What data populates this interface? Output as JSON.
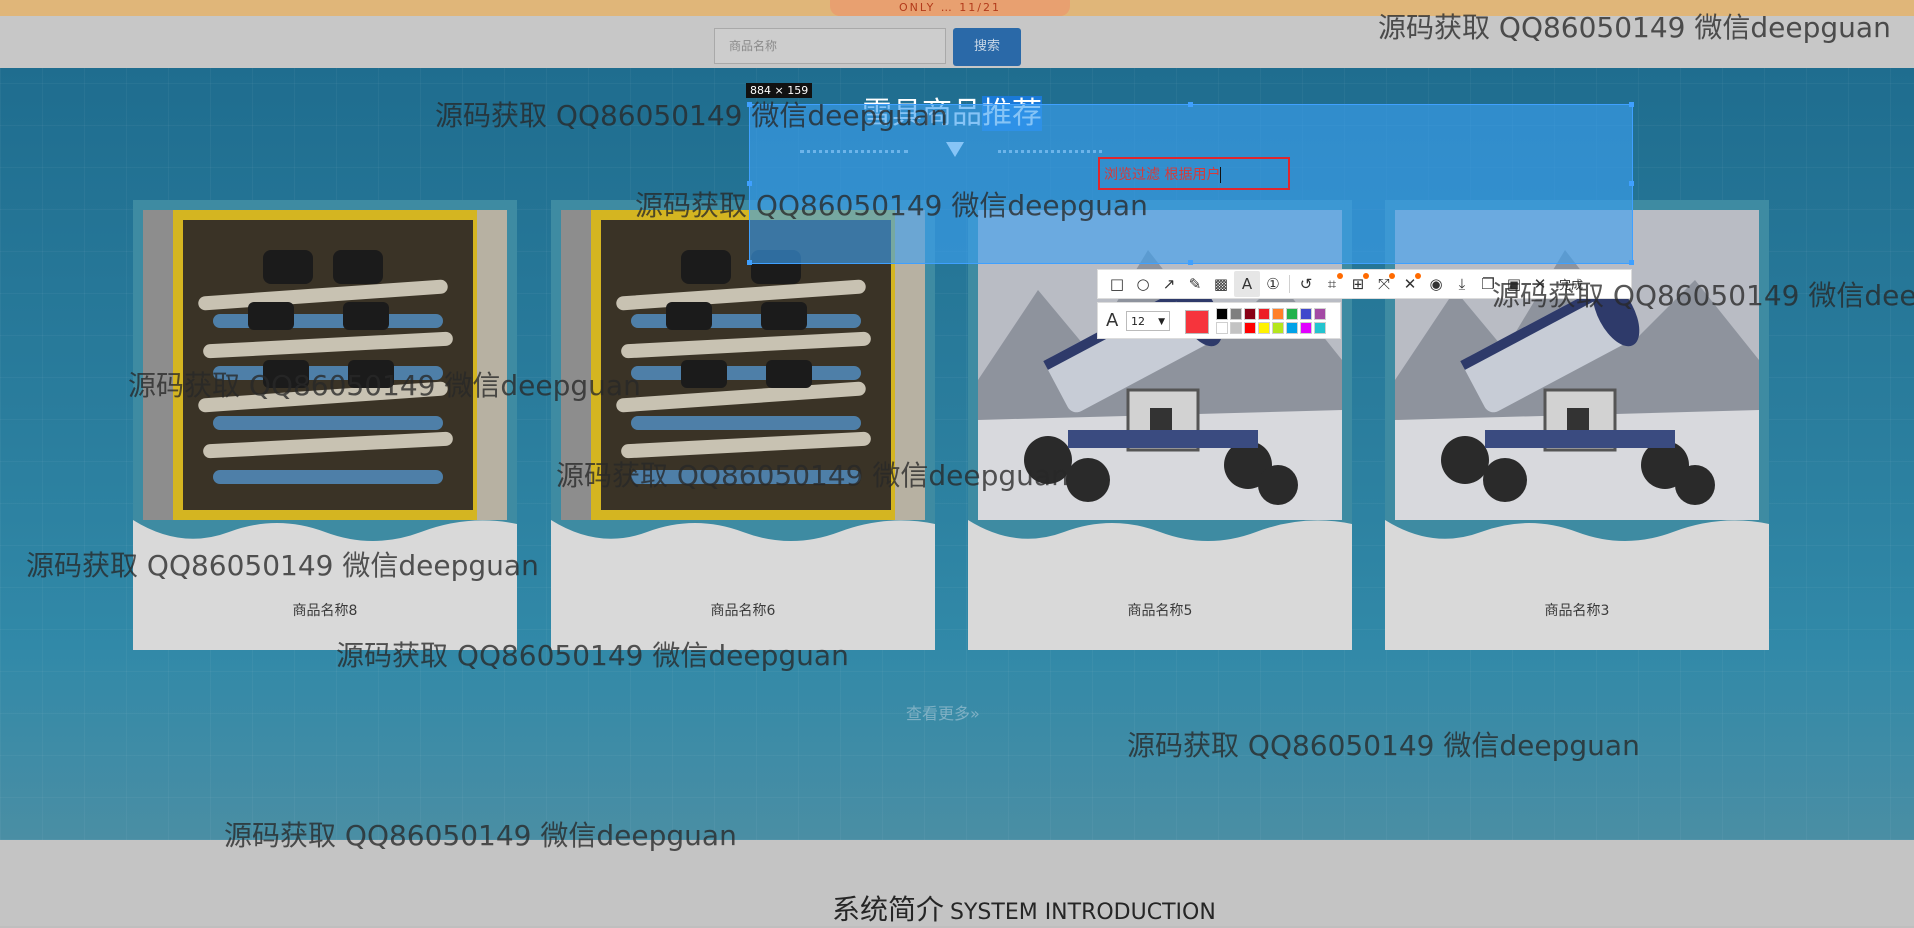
{
  "top_banner": {
    "promo_text": "ONLY … 11/21"
  },
  "search": {
    "placeholder": "商品名称",
    "button_label": "搜索"
  },
  "recommend": {
    "title_prefix": "雪具商品",
    "title_highlight": "推荐",
    "products": [
      {
        "name": "商品名称8",
        "image": "snowboard-rack"
      },
      {
        "name": "商品名称6",
        "image": "snowboard-rack"
      },
      {
        "name": "商品名称5",
        "image": "snow-cannon"
      },
      {
        "name": "商品名称3",
        "image": "snow-cannon"
      }
    ],
    "more_label": "查看更多»"
  },
  "system_intro": {
    "title_cn": "系统简介",
    "title_en": "SYSTEM INTRODUCTION"
  },
  "capture_tool": {
    "dimension_label": "884 × 159",
    "annotation_text": "浏览过滤 根据用户",
    "toolbar_icons": [
      "rectangle-icon",
      "ellipse-icon",
      "arrow-icon",
      "pen-icon",
      "mosaic-icon",
      "text-icon",
      "serial-number-icon",
      "undo-icon",
      "ocr-icon",
      "translate-icon",
      "screenshot-long-icon",
      "pin-icon",
      "record-icon",
      "save-icon",
      "copy-icon",
      "save-as-icon",
      "close-icon"
    ],
    "done_label": "完成",
    "font_size": "12",
    "current_color": "#f6343c",
    "palette": [
      "#000000",
      "#7f7f7f",
      "#880015",
      "#ed1c24",
      "#ff7f27",
      "#22b14c",
      "#3f48cc",
      "#a349a4",
      "#ffffff",
      "#c3c3c3",
      "#ff0000",
      "#fff200",
      "#b5e61d",
      "#00a2e8",
      "#e100ff",
      "#23c4cf"
    ]
  },
  "watermark_text": "源码获取 QQ86050149 微信deepguan"
}
